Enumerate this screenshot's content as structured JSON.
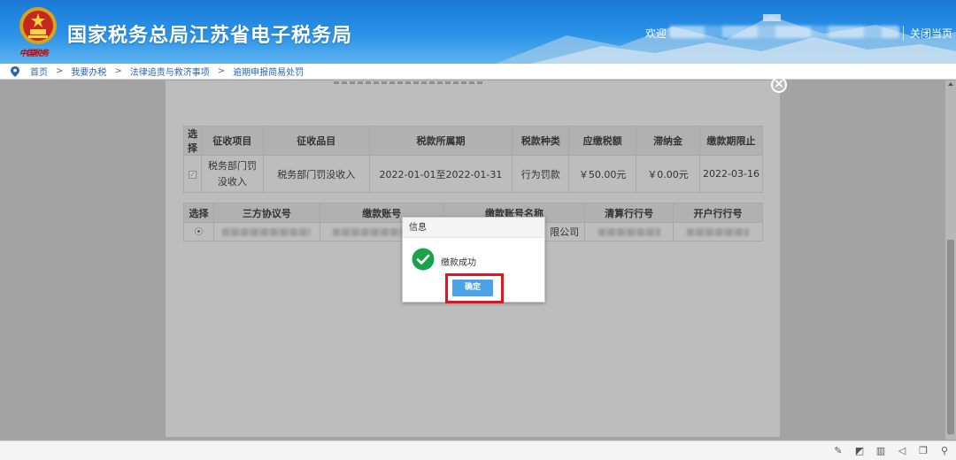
{
  "header": {
    "site_title": "国家税务总局江苏省电子税务局",
    "emblem_caption": "中国税务",
    "welcome": "欢迎",
    "close_page": "关闭当页"
  },
  "breadcrumb": [
    "首页",
    "我要办税",
    "法律追责与救济事项",
    "逾期申报简易处罚"
  ],
  "table1": {
    "headers": [
      "选择",
      "征收项目",
      "征收品目",
      "税款所属期",
      "税款种类",
      "应缴税额",
      "滞纳金",
      "缴款期限止"
    ],
    "row": {
      "checked": "✓",
      "item": "税务部门罚没收入",
      "subitem": "税务部门罚没收入",
      "period": "2022-01-01至2022-01-31",
      "type": "行为罚款",
      "amount": "￥50.00元",
      "late_fee": "￥0.00元",
      "deadline": "2022-03-16"
    }
  },
  "table2": {
    "headers": [
      "选择",
      "三方协议号",
      "缴款账号",
      "缴款账号名称",
      "清算行行号",
      "开户行行号"
    ],
    "row": {
      "account_name_suffix": "限公司"
    }
  },
  "dialog": {
    "title": "信息",
    "message": "缴款成功",
    "ok_label": "确定"
  },
  "colors": {
    "header_blue": "#1b79d6",
    "link_blue": "#2b63b7",
    "ok_button": "#4aa3e8",
    "success_green": "#1aa34a",
    "highlight_red": "#e3141f"
  },
  "icons": {
    "breadcrumb": "location-pin-icon",
    "dialog": "check-circle-icon",
    "modal_close": "close-icon"
  }
}
